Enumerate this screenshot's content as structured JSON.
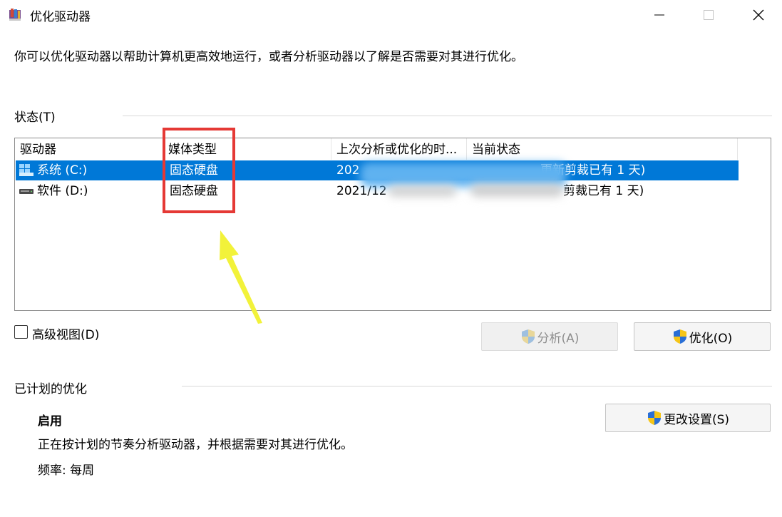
{
  "window": {
    "title": "优化驱动器"
  },
  "description": "你可以优化驱动器以帮助计算机更高效地运行，或者分析驱动器以了解是否需要对其进行优化。",
  "status_group": {
    "label": "状态(T)"
  },
  "table": {
    "headers": {
      "drive": "驱动器",
      "media_type": "媒体类型",
      "last_run": "上次分析或优化的时...",
      "current_status": "当前状态"
    },
    "rows": [
      {
        "drive": "系统 (C:)",
        "media_type": "固态硬盘",
        "last_run": "202",
        "current_status": "更新剪裁已有 1 天)"
      },
      {
        "drive": "软件 (D:)",
        "media_type": "固态硬盘",
        "last_run": "2021/12",
        "current_status": "剪裁已有 1 天)"
      }
    ]
  },
  "advanced_view": {
    "label": "高级视图(D)"
  },
  "buttons": {
    "analyze": "分析(A)",
    "optimize": "优化(O)",
    "change_settings": "更改设置(S)"
  },
  "scheduled": {
    "label": "已计划的优化",
    "state": "启用",
    "description": "正在按计划的节奏分析驱动器，并根据需要对其进行优化。",
    "frequency": "频率: 每周"
  },
  "colors": {
    "selection": "#0078d7",
    "highlight_box": "#e53935",
    "arrow": "#f2f23a"
  }
}
